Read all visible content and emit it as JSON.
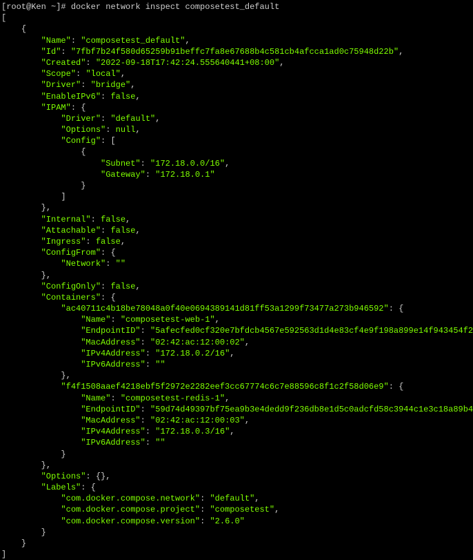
{
  "prompt": "[root@Ken ~]# ",
  "command": "docker network inspect composetest_default",
  "network": {
    "name_key": "\"Name\"",
    "name_val": "\"composetest_default\"",
    "id_key": "\"Id\"",
    "id_val": "\"7fbf7b24f580d65259b91beffc7fa8e67688b4c581cb4afcca1ad0c75948d22b\"",
    "created_key": "\"Created\"",
    "created_val": "\"2022-09-18T17:42:24.555640441+08:00\"",
    "scope_key": "\"Scope\"",
    "scope_val": "\"local\"",
    "driver_key": "\"Driver\"",
    "driver_val": "\"bridge\"",
    "enableipv6_key": "\"EnableIPv6\"",
    "enableipv6_val": "false",
    "ipam_key": "\"IPAM\"",
    "ipam_driver_key": "\"Driver\"",
    "ipam_driver_val": "\"default\"",
    "ipam_options_key": "\"Options\"",
    "ipam_options_val": "null",
    "ipam_config_key": "\"Config\"",
    "subnet_key": "\"Subnet\"",
    "subnet_val": "\"172.18.0.0/16\"",
    "gateway_key": "\"Gateway\"",
    "gateway_val": "\"172.18.0.1\"",
    "internal_key": "\"Internal\"",
    "internal_val": "false",
    "attachable_key": "\"Attachable\"",
    "attachable_val": "false",
    "ingress_key": "\"Ingress\"",
    "ingress_val": "false",
    "configfrom_key": "\"ConfigFrom\"",
    "configfrom_network_key": "\"Network\"",
    "configfrom_network_val": "\"\"",
    "configonly_key": "\"ConfigOnly\"",
    "configonly_val": "false",
    "containers_key": "\"Containers\"",
    "c1_id": "\"ac40711c4b18be78048a0f40e0694389141d81ff53a1299f73477a273b946592\"",
    "c1_name_key": "\"Name\"",
    "c1_name_val": "\"composetest-web-1\"",
    "c1_endpoint_key": "\"EndpointID\"",
    "c1_endpoint_val": "\"5afecfed0cf320e7bfdcb4567e592563d1d4e83cf4e9f198a899e14f943454f2\"",
    "c1_mac_key": "\"MacAddress\"",
    "c1_mac_val": "\"02:42:ac:12:00:02\"",
    "c1_ipv4_key": "\"IPv4Address\"",
    "c1_ipv4_val": "\"172.18.0.2/16\"",
    "c1_ipv6_key": "\"IPv6Address\"",
    "c1_ipv6_val": "\"\"",
    "c2_id": "\"f4f1508aaef4218ebf5f2972e2282eef3cc67774c6c7e88596c8f1c2f58d06e9\"",
    "c2_name_key": "\"Name\"",
    "c2_name_val": "\"composetest-redis-1\"",
    "c2_endpoint_key": "\"EndpointID\"",
    "c2_endpoint_val": "\"59d74d49397bf75ea9b3e4dedd9f236db8e1d5c0adcfd58c3944c1e3c18a89b4\"",
    "c2_mac_key": "\"MacAddress\"",
    "c2_mac_val": "\"02:42:ac:12:00:03\"",
    "c2_ipv4_key": "\"IPv4Address\"",
    "c2_ipv4_val": "\"172.18.0.3/16\"",
    "c2_ipv6_key": "\"IPv6Address\"",
    "c2_ipv6_val": "\"\"",
    "options_key": "\"Options\"",
    "options_val": "{}",
    "labels_key": "\"Labels\"",
    "label1_key": "\"com.docker.compose.network\"",
    "label1_val": "\"default\"",
    "label2_key": "\"com.docker.compose.project\"",
    "label2_val": "\"composetest\"",
    "label3_key": "\"com.docker.compose.version\"",
    "label3_val": "\"2.6.0\""
  }
}
